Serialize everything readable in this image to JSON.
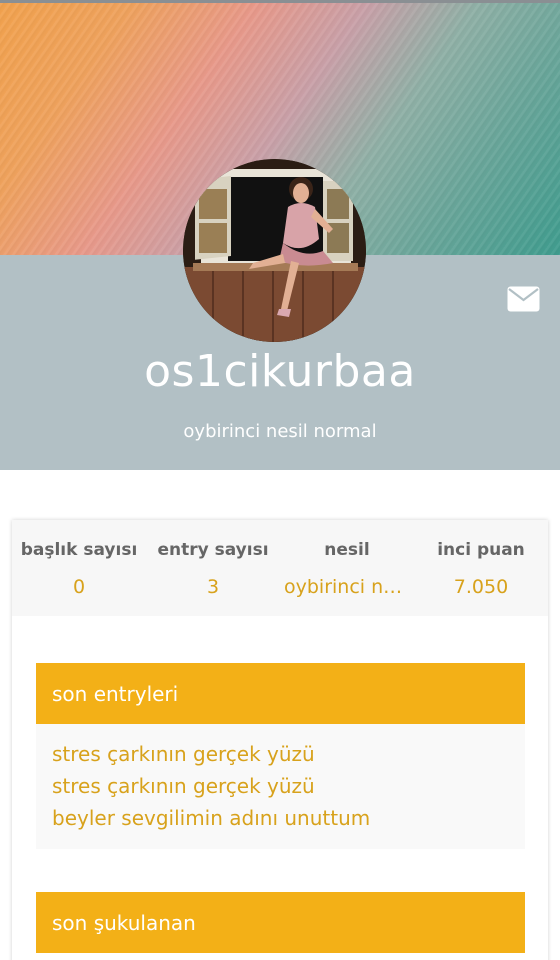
{
  "profile": {
    "username": "os1cikurbaa",
    "subtitle": "oybirinci nesil normal"
  },
  "stats": [
    {
      "label": "başlık sayısı",
      "value": "0"
    },
    {
      "label": "entry sayısı",
      "value": "3"
    },
    {
      "label": "nesil",
      "value": "oybirinci nesi..."
    },
    {
      "label": "inci puan",
      "value": "7.050"
    }
  ],
  "sections": {
    "recent_entries": {
      "title": "son entryleri",
      "items": [
        "stres çarkının gerçek yüzü",
        "stres çarkının gerçek yüzü",
        "beyler sevgilimin adını unuttum"
      ]
    },
    "recent_likes": {
      "title": "son şukulanan"
    }
  },
  "colors": {
    "accent": "#f3b017",
    "value_text": "#d8a21c",
    "profile_band": "#b2c0c5"
  },
  "icons": {
    "message": "mail-icon"
  }
}
